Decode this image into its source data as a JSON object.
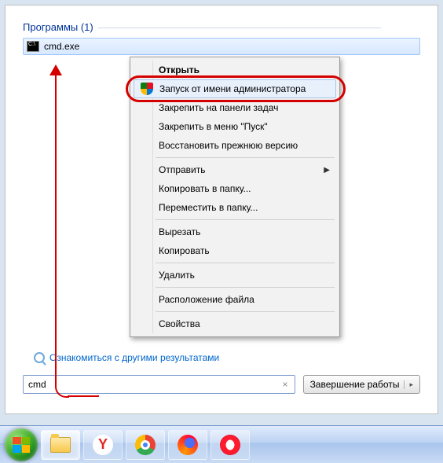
{
  "section_header": "Программы (1)",
  "result": {
    "name": "cmd.exe"
  },
  "context_menu": {
    "open": "Открыть",
    "run_as_admin": "Запуск от имени администратора",
    "pin_taskbar": "Закрепить на панели задач",
    "pin_start": "Закрепить в меню \"Пуск\"",
    "restore_previous": "Восстановить прежнюю версию",
    "send_to": "Отправить",
    "copy_to_folder": "Копировать в папку...",
    "move_to_folder": "Переместить в папку...",
    "cut": "Вырезать",
    "copy": "Копировать",
    "delete": "Удалить",
    "open_location": "Расположение файла",
    "properties": "Свойства"
  },
  "more_results": "Ознакомиться с другими результатами",
  "search": {
    "value": "cmd",
    "clear": "×"
  },
  "shutdown": {
    "label": "Завершение работы",
    "arrow": "▸"
  },
  "taskbar": {
    "start": "start-button",
    "items": [
      "explorer",
      "yandex",
      "chrome",
      "firefox",
      "opera"
    ]
  }
}
